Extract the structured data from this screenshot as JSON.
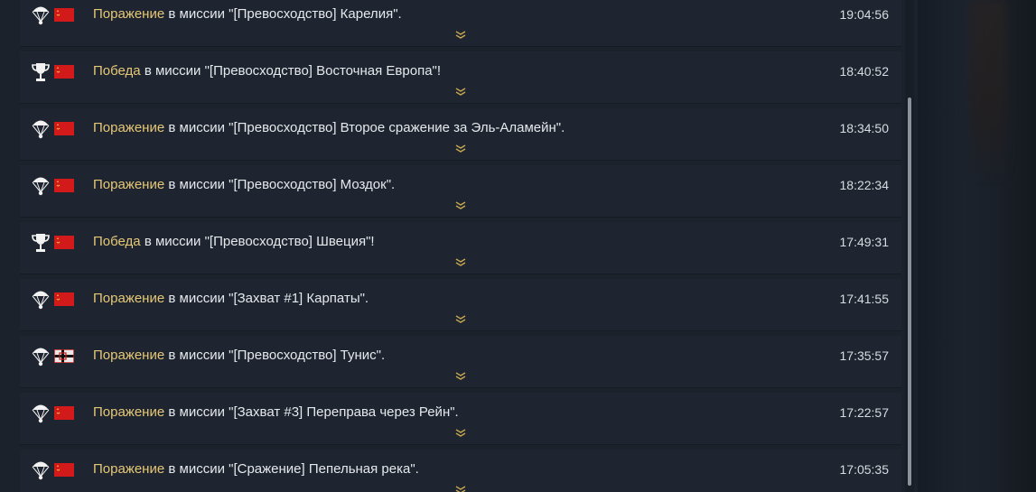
{
  "entries": [
    {
      "result": "defeat",
      "outcome": "Поражение",
      "message": " в миссии \"[Превосходство] Карелия\".",
      "time": "19:04:56",
      "nation": "ussr",
      "result_icon": "parachute-icon",
      "flag_icon": "ussr-flag-icon"
    },
    {
      "result": "victory",
      "outcome": "Победа",
      "message": " в миссии \"[Превосходство] Восточная Европа\"!",
      "time": "18:40:52",
      "nation": "ussr",
      "result_icon": "trophy-icon",
      "flag_icon": "ussr-flag-icon"
    },
    {
      "result": "defeat",
      "outcome": "Поражение",
      "message": " в миссии \"[Превосходство] Второе сражение за Эль-Аламейн\".",
      "time": "18:34:50",
      "nation": "ussr",
      "result_icon": "parachute-icon",
      "flag_icon": "ussr-flag-icon"
    },
    {
      "result": "defeat",
      "outcome": "Поражение",
      "message": " в миссии \"[Превосходство] Моздок\".",
      "time": "18:22:34",
      "nation": "ussr",
      "result_icon": "parachute-icon",
      "flag_icon": "ussr-flag-icon"
    },
    {
      "result": "victory",
      "outcome": "Победа",
      "message": " в миссии \"[Превосходство] Швеция\"!",
      "time": "17:49:31",
      "nation": "ussr",
      "result_icon": "trophy-icon",
      "flag_icon": "ussr-flag-icon"
    },
    {
      "result": "defeat",
      "outcome": "Поражение",
      "message": " в миссии \"[Захват #1] Карпаты\".",
      "time": "17:41:55",
      "nation": "ussr",
      "result_icon": "parachute-icon",
      "flag_icon": "ussr-flag-icon"
    },
    {
      "result": "defeat",
      "outcome": "Поражение",
      "message": " в миссии \"[Превосходство] Тунис\".",
      "time": "17:35:57",
      "nation": "germany",
      "result_icon": "parachute-icon",
      "flag_icon": "germany-flag-icon"
    },
    {
      "result": "defeat",
      "outcome": "Поражение",
      "message": " в миссии \"[Захват #3] Переправа через Рейн\".",
      "time": "17:22:57",
      "nation": "ussr",
      "result_icon": "parachute-icon",
      "flag_icon": "ussr-flag-icon"
    },
    {
      "result": "defeat",
      "outcome": "Поражение",
      "message": " в миссии \"[Сражение] Пепельная река\".",
      "time": "17:05:35",
      "nation": "ussr",
      "result_icon": "parachute-icon",
      "flag_icon": "ussr-flag-icon"
    }
  ],
  "colors": {
    "outcome_text": "#e6c876",
    "message_text": "#e6e9ec",
    "ussr_red": "#d21a1a",
    "expand_gold": "#c8a84e"
  },
  "expand_icon": "chevron-double-down-icon"
}
